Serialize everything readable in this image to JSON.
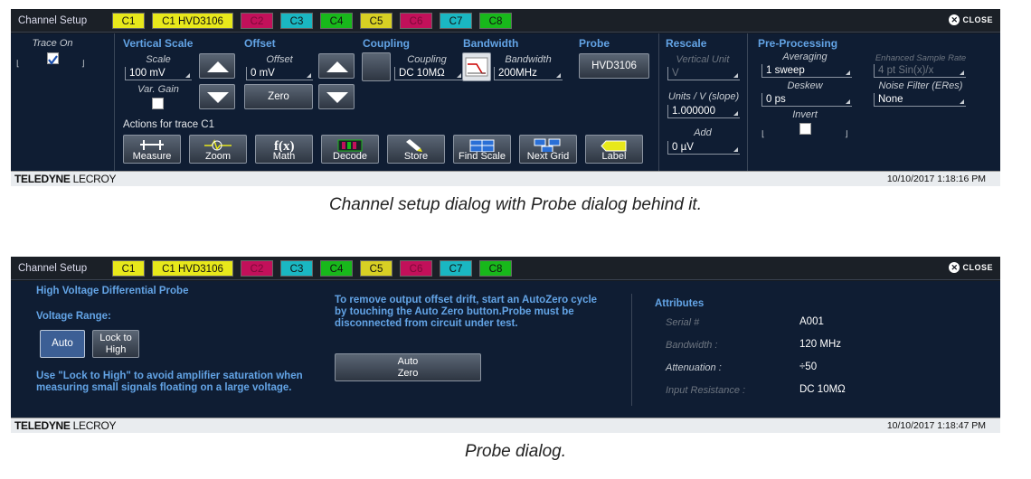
{
  "colors": {
    "c1": "#e8e81b",
    "c2": "#c2105a",
    "c3": "#1ab7c2",
    "c4": "#18b81b",
    "c5": "#d8d024",
    "c6": "#c2105a",
    "c7": "#1ab7c2",
    "c8": "#18b81b",
    "accent": "#63a4e6"
  },
  "tabs": {
    "setup": "Channel Setup",
    "c1": "C1",
    "c1probe": "C1 HVD3106",
    "c2": "C2",
    "c3": "C3",
    "c4": "C4",
    "c5": "C5",
    "c6": "C6",
    "c7": "C7",
    "c8": "C8",
    "close": "CLOSE"
  },
  "footer": {
    "brand_a": "TELEDYNE",
    "brand_b": "LECROY",
    "ts1": "10/10/2017 1:18:16 PM",
    "ts2": "10/10/2017 1:18:47 PM"
  },
  "setup": {
    "trace_on": "Trace On",
    "vertical_scale": "Vertical Scale",
    "scale_label": "Scale",
    "scale_value": "100 mV",
    "var_gain": "Var. Gain",
    "offset_hdr": "Offset",
    "offset_label": "Offset",
    "offset_value": "0 mV",
    "zero": "Zero",
    "coupling_hdr": "Coupling",
    "coupling_label": "Coupling",
    "coupling_value": "DC 10MΩ",
    "bandwidth_hdr": "Bandwidth",
    "bandwidth_label": "Bandwidth",
    "bandwidth_value": "200MHz",
    "probe_hdr": "Probe",
    "probe_value": "HVD3106",
    "rescale_hdr": "Rescale",
    "vertical_unit": "Vertical Unit",
    "vertical_unit_value": "V",
    "units_slope": "Units / V (slope)",
    "slope_value": "1.000000",
    "add": "Add",
    "add_value": "0 µV",
    "preproc_hdr": "Pre-Processing",
    "averaging": "Averaging",
    "averaging_value": "1 sweep",
    "deskew": "Deskew",
    "deskew_value": "0 ps",
    "invert": "Invert",
    "esr": "Enhanced Sample Rate",
    "esr_value": "4 pt Sin(x)/x",
    "noise": "Noise Filter (ERes)",
    "noise_value": "None",
    "actions": "Actions for trace C1",
    "btns": [
      "Measure",
      "Zoom",
      "Math",
      "Decode",
      "Store",
      "Find Scale",
      "Next Grid",
      "Label"
    ]
  },
  "caption1": "Channel setup dialog with Probe dialog behind it.",
  "probe": {
    "title": "High Voltage Differential Probe",
    "range": "Voltage Range:",
    "auto": "Auto",
    "lock1": "Lock to",
    "lock2": "High",
    "note1": "Use \"Lock to High\" to avoid amplifier saturation when",
    "note2": "measuring small signals  floating on a large voltage.",
    "msg1": "To remove output offset drift, start an AutoZero cycle",
    "msg2": "by  touching the Auto Zero button.Probe must be",
    "msg3": "disconnected from circuit under test.",
    "az1": "Auto",
    "az2": "Zero",
    "attributes": "Attributes",
    "attrs": [
      {
        "k": "Serial #",
        "v": "A001"
      },
      {
        "k": "Bandwidth :",
        "v": "120 MHz"
      },
      {
        "k": "Attenuation :",
        "v": "÷50"
      },
      {
        "k": "Input Resistance :",
        "v": "DC 10MΩ"
      }
    ]
  },
  "caption2": "Probe dialog."
}
